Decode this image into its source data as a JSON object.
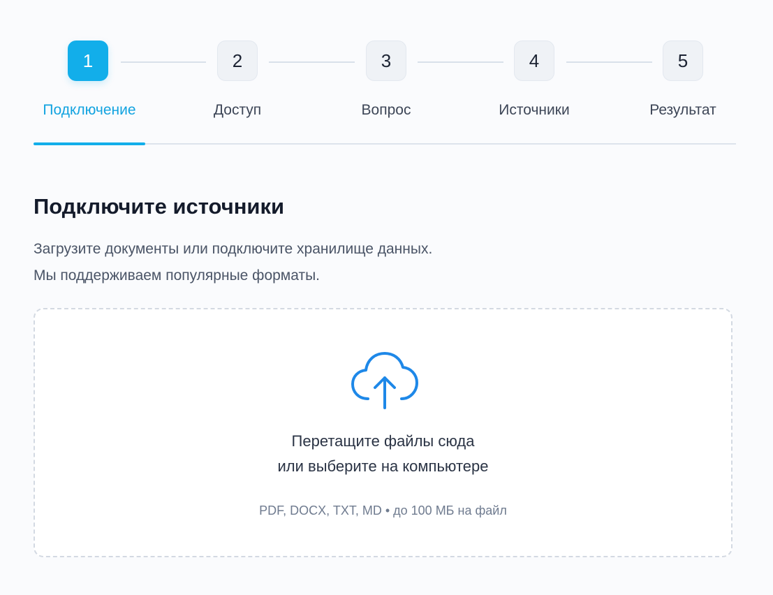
{
  "colors": {
    "accent": "#12aeea",
    "inactive_step_bg": "#eff2f6",
    "connector": "#d9e0ea"
  },
  "steps": [
    {
      "number": "1",
      "label": "Подключение",
      "active": true
    },
    {
      "number": "2",
      "label": "Доступ",
      "active": false
    },
    {
      "number": "3",
      "label": "Вопрос",
      "active": false
    },
    {
      "number": "4",
      "label": "Источники",
      "active": false
    },
    {
      "number": "5",
      "label": "Результат",
      "active": false
    }
  ],
  "section": {
    "title": "Подключите источники",
    "description_line1": "Загрузите документы или подключите хранилище данных.",
    "description_line2": "Мы поддерживаем популярные форматы."
  },
  "dropzone": {
    "icon": "cloud-upload-icon",
    "line1": "Перетащите файлы сюда",
    "line2": "или выберите на компьютере",
    "hint": "PDF, DOCX, TXT, MD • до 100 МБ на файл"
  }
}
